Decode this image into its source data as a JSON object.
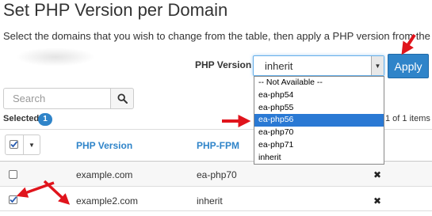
{
  "page": {
    "title": "Set PHP Version per Domain",
    "description": "Select the domains that you wish to change from the table, then apply a PHP version from the list."
  },
  "php_version_control": {
    "label": "PHP Version",
    "selected_value": "inherit",
    "apply_label": "Apply",
    "options": [
      "-- Not Available --",
      "ea-php54",
      "ea-php55",
      "ea-php56",
      "ea-php70",
      "ea-php71",
      "inherit"
    ],
    "highlighted_option": "ea-php56"
  },
  "search": {
    "placeholder": "Search"
  },
  "selection": {
    "label": "Selected",
    "count": "1"
  },
  "pagination": {
    "text": "1 of 1 items"
  },
  "table": {
    "columns": [
      "PHP Version",
      "PHP-FPM"
    ],
    "rows": [
      {
        "domain": "example.com",
        "php_version": "ea-php70",
        "fpm": "✖",
        "checked": false
      },
      {
        "domain": "example2.com",
        "php_version": "inherit",
        "fpm": "✖",
        "checked": true
      }
    ]
  },
  "colors": {
    "accent": "#2f84c9",
    "annotation_red": "#e0141c",
    "highlight": "#2a79d4"
  },
  "icons": [
    "search-icon",
    "checkmark-icon",
    "caret-down-icon",
    "close-icon",
    "arrow-annotation"
  ]
}
